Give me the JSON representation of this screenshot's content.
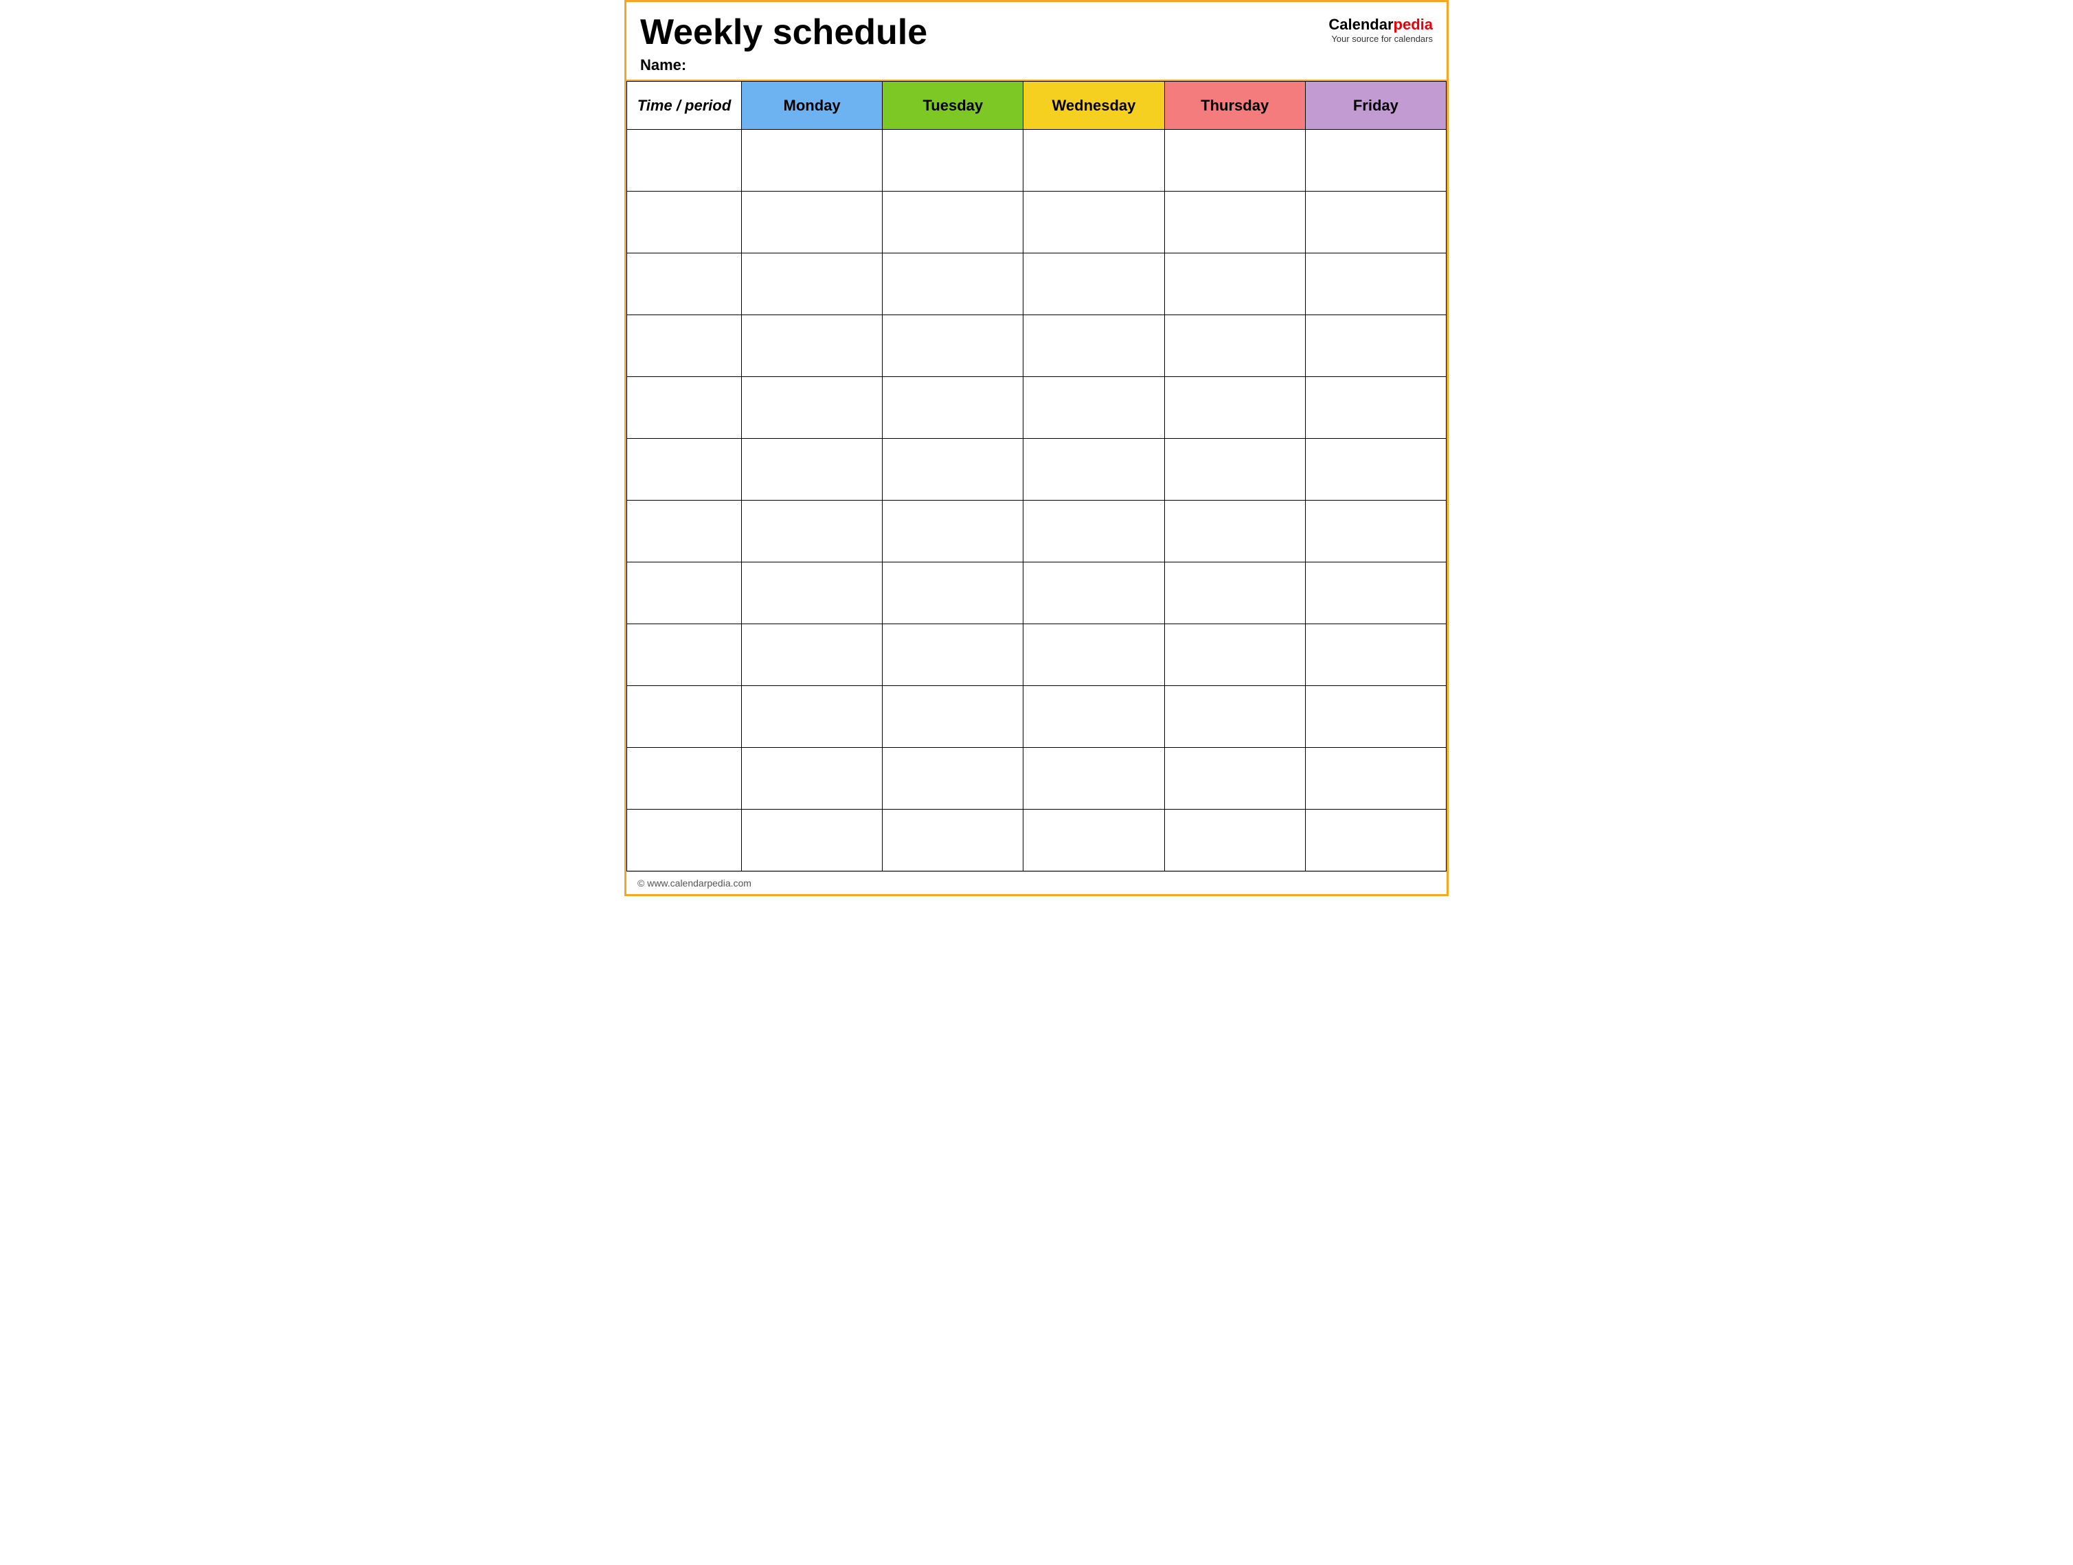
{
  "header": {
    "title": "Weekly schedule",
    "name_label": "Name:",
    "logo_calendar": "Calendar",
    "logo_pedia": "pedia",
    "logo_tagline": "Your source for calendars"
  },
  "table": {
    "columns": [
      {
        "id": "time",
        "label": "Time / period",
        "color": "#fff"
      },
      {
        "id": "monday",
        "label": "Monday",
        "color": "#6db3f2"
      },
      {
        "id": "tuesday",
        "label": "Tuesday",
        "color": "#7ec825"
      },
      {
        "id": "wednesday",
        "label": "Wednesday",
        "color": "#f5d020"
      },
      {
        "id": "thursday",
        "label": "Thursday",
        "color": "#f47c7c"
      },
      {
        "id": "friday",
        "label": "Friday",
        "color": "#c39bd3"
      }
    ],
    "row_count": 12
  },
  "footer": {
    "url": "© www.calendarpedia.com"
  }
}
